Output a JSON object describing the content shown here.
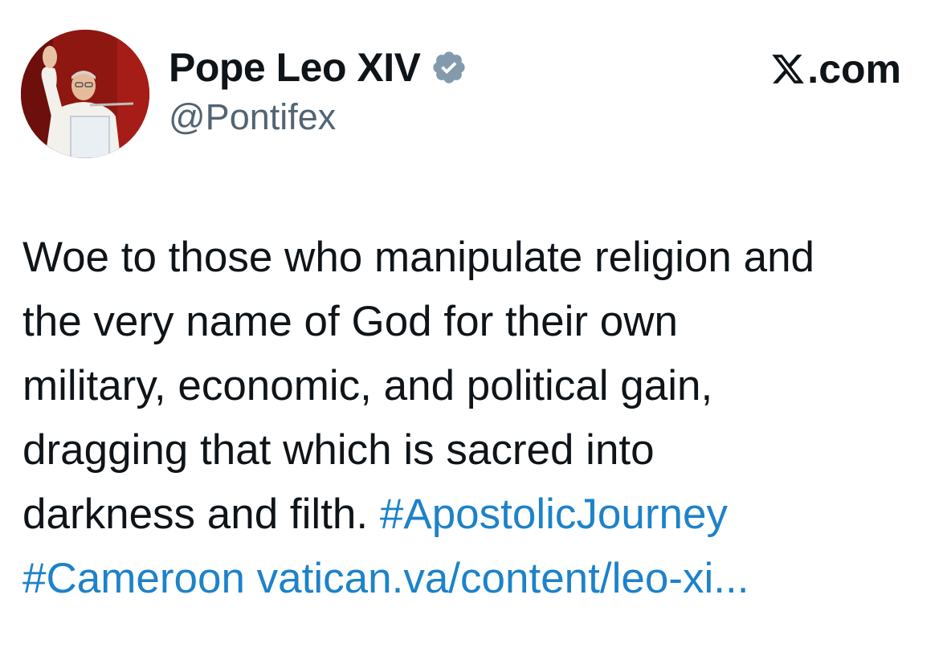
{
  "author": {
    "display_name": "Pope Leo XIV",
    "handle": "@Pontifex",
    "verified": true,
    "avatar": "pope-waving-avatar"
  },
  "site": {
    "icon": "x-logo-icon",
    "label": ".com"
  },
  "tweet": {
    "lines": [
      "Woe to those who manipulate religion and",
      "the very name of God for their own",
      "military, economic, and political gain,",
      "dragging that which is sacred into",
      "darkness and filth."
    ],
    "hashtags": [
      "#ApostolicJourney",
      "#Cameroon"
    ],
    "link": "vatican.va/content/leo-xi..."
  },
  "colors": {
    "link": "#1d82c9",
    "verified_badge": "#829aab",
    "text": "#0f1419",
    "handle": "#536471"
  }
}
